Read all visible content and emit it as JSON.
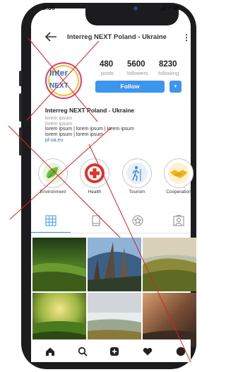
{
  "status_bar": {
    "time": "8:30",
    "icons": "..ıl ᯤ ▬"
  },
  "header": {
    "username": "Interreg NEXT Poland - Ukraine",
    "more_icon": "⋮"
  },
  "avatar": {
    "logo_top": "Inter",
    "logo_bottom": "NEXT"
  },
  "stats": [
    {
      "value": "480",
      "label": "posts"
    },
    {
      "value": "5600",
      "label": "followers"
    },
    {
      "value": "8230",
      "label": "following"
    }
  ],
  "follow_button": "Follow",
  "dropdown_glyph": "▾",
  "bio": {
    "name": "Interreg NEXT Poland - Ukraine",
    "lines": [
      "lorem ipsum",
      "lorem ipsum",
      "lorem ipsum | lorem ipsum | lorem ipsum",
      "lorem ipsum | lorem ipsum"
    ],
    "link": "pl-ua.eu"
  },
  "highlights": [
    {
      "label": "Environment",
      "icon": "leaf-icon",
      "color": "#6cbf3c"
    },
    {
      "label": "Health",
      "icon": "cross-icon",
      "color": "#e0322f"
    },
    {
      "label": "Tourism",
      "icon": "hiker-icon",
      "color": "#4a8fd0"
    },
    {
      "label": "Cooperation",
      "icon": "handshake-icon",
      "color": "#f2b51a"
    }
  ],
  "tabs": [
    "grid-icon",
    "reels-icon",
    "tagged-star-icon",
    "portrait-icon"
  ],
  "photos": [
    "forest-meadow",
    "tall-trees",
    "hill-sunset",
    "sunrise-forest",
    "misty-field",
    "storm-sky"
  ],
  "bottom_nav": [
    "home-icon",
    "search-icon",
    "add-icon",
    "heart-icon",
    "profile-icon"
  ],
  "colors": {
    "accent": "#3d95ee",
    "cross_overlay": "#e02020",
    "brand_blue": "#2c6fb5"
  }
}
